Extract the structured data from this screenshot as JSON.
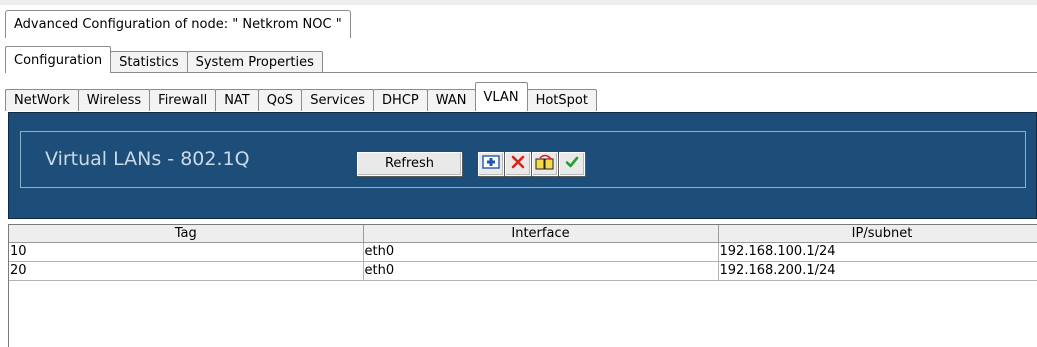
{
  "window": {
    "node_title": "Advanced Configuration of node:  \" Netkrom NOC \""
  },
  "main_tabs": [
    {
      "label": "Configuration",
      "active": true
    },
    {
      "label": "Statistics",
      "active": false
    },
    {
      "label": "System Properties",
      "active": false
    }
  ],
  "config_tabs": [
    {
      "label": "NetWork",
      "active": false
    },
    {
      "label": "Wireless",
      "active": false
    },
    {
      "label": "Firewall",
      "active": false
    },
    {
      "label": "NAT",
      "active": false
    },
    {
      "label": "QoS",
      "active": false
    },
    {
      "label": "Services",
      "active": false
    },
    {
      "label": "DHCP",
      "active": false
    },
    {
      "label": "WAN",
      "active": false
    },
    {
      "label": "VLAN",
      "active": true
    },
    {
      "label": "HotSpot",
      "active": false
    }
  ],
  "panel": {
    "title": "Virtual LANs - 802.1Q",
    "refresh_label": "Refresh",
    "icons": [
      "add-icon",
      "delete-icon",
      "copy-icon",
      "apply-check-icon"
    ],
    "bg_color": "#1d4e7a"
  },
  "table": {
    "columns": [
      "Tag",
      "Interface",
      "IP/subnet"
    ],
    "rows": [
      [
        "10",
        "eth0",
        "192.168.100.1/24"
      ],
      [
        "20",
        "eth0",
        "192.168.200.1/24"
      ]
    ]
  }
}
